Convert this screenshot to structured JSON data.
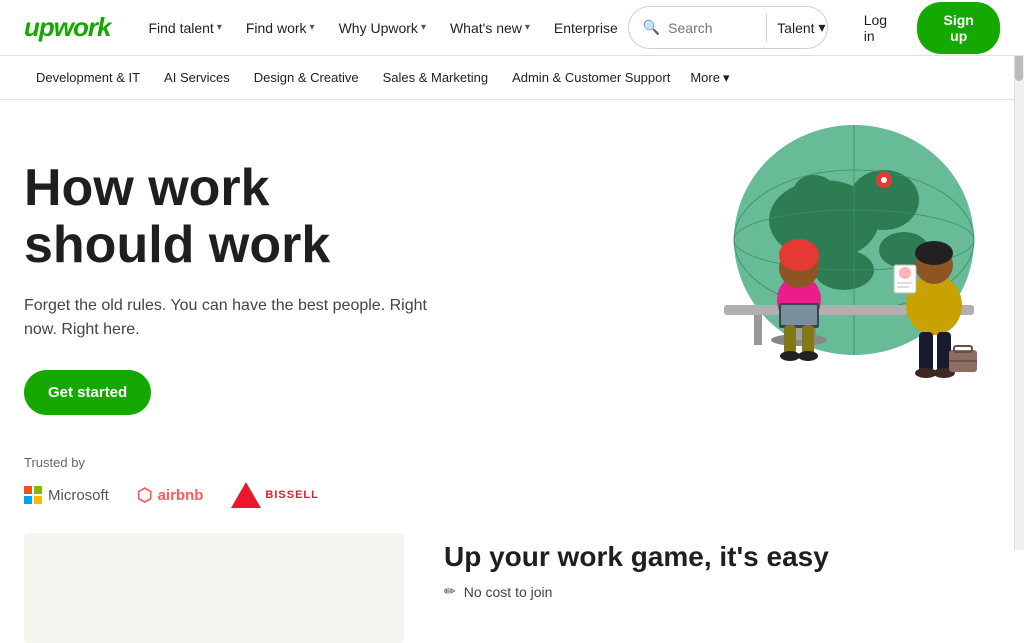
{
  "logo": {
    "text": "upwork"
  },
  "topnav": {
    "links": [
      {
        "label": "Find talent",
        "hasChevron": true
      },
      {
        "label": "Find work",
        "hasChevron": true
      },
      {
        "label": "Why Upwork",
        "hasChevron": true
      },
      {
        "label": "What's new",
        "hasChevron": true
      },
      {
        "label": "Enterprise",
        "hasChevron": false
      }
    ],
    "search": {
      "placeholder": "Search",
      "talent_label": "Talent"
    },
    "login_label": "Log in",
    "signup_label": "Sign up"
  },
  "secondary_nav": {
    "links": [
      "Development & IT",
      "AI Services",
      "Design & Creative",
      "Sales & Marketing",
      "Admin & Customer Support"
    ],
    "more_label": "More"
  },
  "hero": {
    "title": "How work should work",
    "subtitle": "Forget the old rules. You can have the best people. Right now. Right here.",
    "cta_label": "Get started"
  },
  "trusted": {
    "label": "Trusted by",
    "logos": [
      "Microsoft",
      "airbnb",
      "BISSELL"
    ]
  },
  "bottom": {
    "title": "Up your work game, it's easy",
    "items": [
      "No cost to join"
    ]
  }
}
